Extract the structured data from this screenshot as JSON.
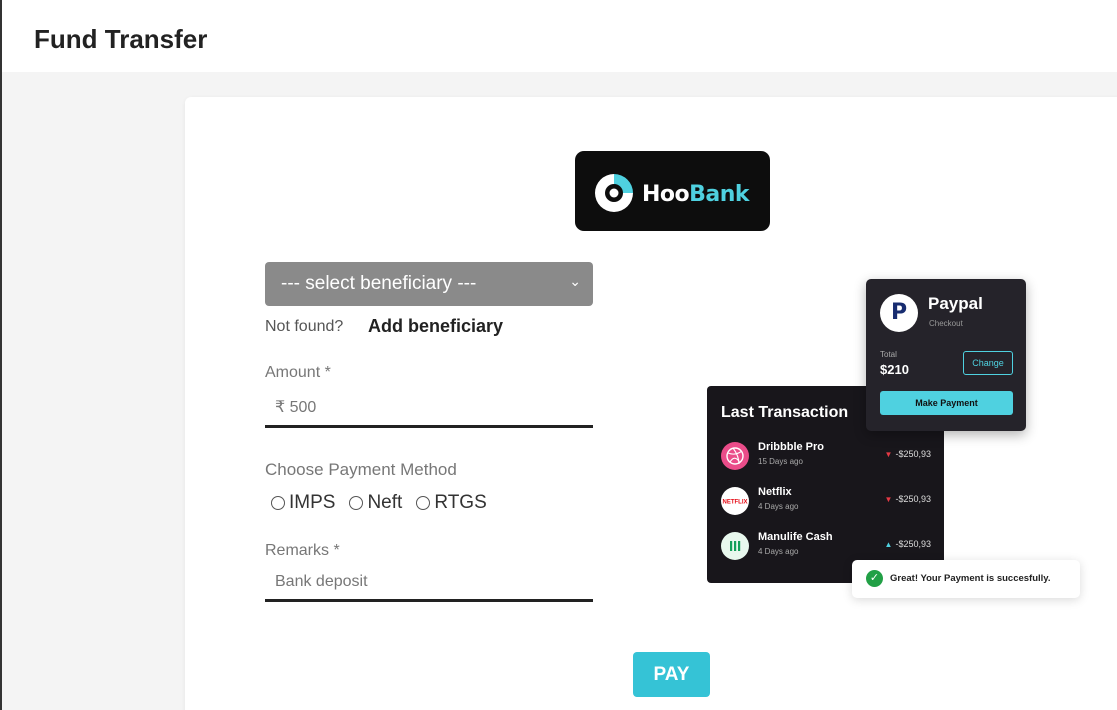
{
  "header": {
    "title": "Fund Transfer"
  },
  "logo": {
    "prefix": "Hoo",
    "accent": "Bank"
  },
  "form": {
    "beneficiary_select": {
      "value": "--- select beneficiary ---"
    },
    "not_found_text": "Not found?",
    "add_beneficiary_label": "Add beneficiary",
    "amount": {
      "label": "Amount *",
      "placeholder": "₹ 500"
    },
    "payment_method": {
      "label": "Choose Payment Method",
      "options": [
        "IMPS",
        "Neft",
        "RTGS"
      ]
    },
    "remarks": {
      "label": "Remarks *",
      "placeholder": "Bank deposit"
    },
    "pay_label": "PAY"
  },
  "illustration": {
    "last_transaction": {
      "title": "Last Transaction",
      "items": [
        {
          "name": "Dribbble Pro",
          "time": "15 Days ago",
          "amount": "-$250,93",
          "trend": "down"
        },
        {
          "name": "Netflix",
          "time": "4 Days ago",
          "amount": "-$250,93",
          "trend": "down"
        },
        {
          "name": "Manulife Cash",
          "time": "4 Days ago",
          "amount": "-$250,93",
          "trend": "up"
        }
      ]
    },
    "paypal": {
      "title": "Paypal",
      "subtitle": "Checkout",
      "total_label": "Total",
      "total_value": "$210",
      "change_label": "Change",
      "make_payment_label": "Make Payment"
    },
    "toast": {
      "message": "Great! Your Payment is succesfully."
    }
  },
  "colors": {
    "accent": "#35c3d6",
    "brand_accent": "#4fd1e0",
    "success": "#22a046",
    "dribbble": "#ea4c89",
    "netflix": "#e50914"
  },
  "icons": [
    "hoobank-logo-icon",
    "chevron-down-icon",
    "paypal-icon",
    "dribbble-icon",
    "netflix-icon",
    "manulife-icon",
    "check-circle-icon"
  ]
}
